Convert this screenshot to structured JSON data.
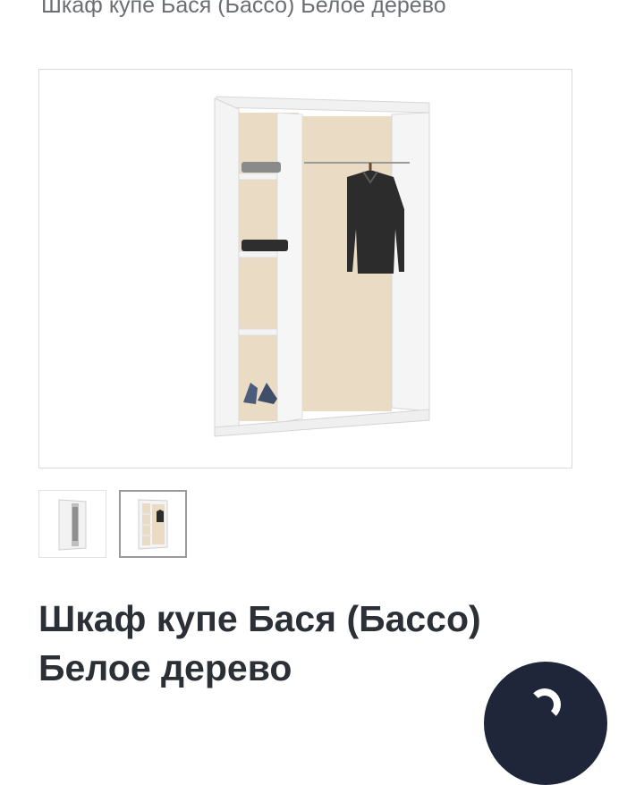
{
  "header": {
    "title": "Шкаф купе Бася (Бассо) Белое дерево"
  },
  "gallery": {
    "main_image_icon": "wardrobe-image",
    "thumbnails": [
      {
        "icon": "wardrobe-closed-image",
        "selected": false
      },
      {
        "icon": "wardrobe-open-image",
        "selected": true
      }
    ]
  },
  "product": {
    "title_line1": "Шкаф купе Бася (Бассо)",
    "title_line2": "Белое дерево"
  },
  "fab": {
    "icon": "chat-icon",
    "color": "#20263a"
  }
}
